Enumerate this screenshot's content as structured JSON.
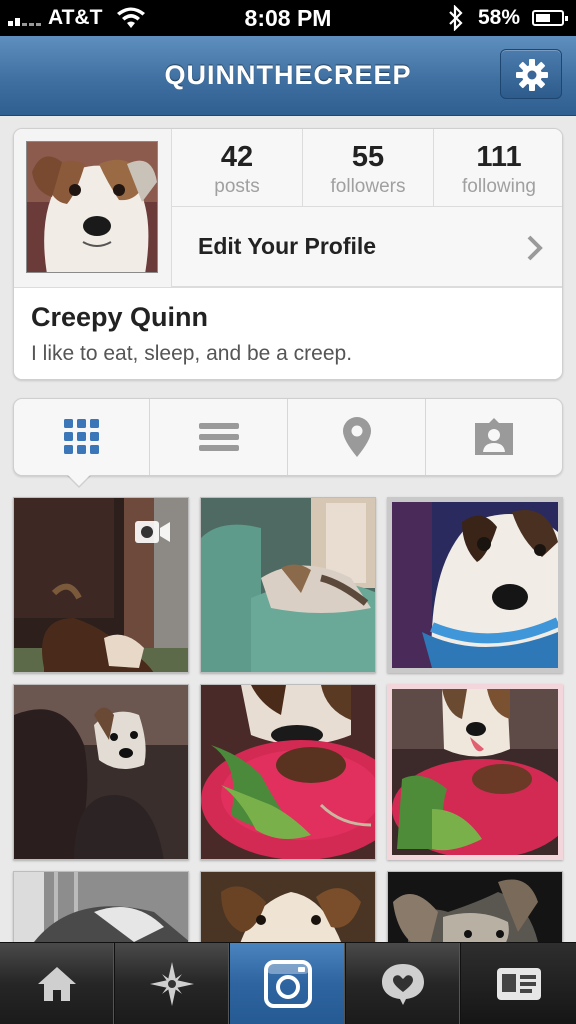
{
  "status_bar": {
    "carrier": "AT&T",
    "time": "8:08 PM",
    "battery_percent_label": "58%",
    "battery_level": 0.58,
    "signal_bars": 2
  },
  "nav_bar": {
    "title": "QUINNTHECREEP",
    "settings_icon": "gear-icon",
    "color": "#3f70a1"
  },
  "profile": {
    "stats": [
      {
        "value": "42",
        "label": "posts"
      },
      {
        "value": "55",
        "label": "followers"
      },
      {
        "value": "111",
        "label": "following"
      }
    ],
    "edit_label": "Edit Your Profile",
    "display_name": "Creepy Quinn",
    "bio": "I like to eat, sleep, and be a creep."
  },
  "view_tabs": [
    {
      "icon": "grid-icon",
      "selected": true
    },
    {
      "icon": "list-icon",
      "selected": false
    },
    {
      "icon": "location-pin-icon",
      "selected": false
    },
    {
      "icon": "tagged-photos-icon",
      "selected": false
    }
  ],
  "photos": [
    {
      "subject": "dog-in-dark-room",
      "is_video": true
    },
    {
      "subject": "dog-on-green-chair",
      "is_video": false
    },
    {
      "subject": "dog-with-blue-scarf",
      "is_video": false
    },
    {
      "subject": "dog-with-person",
      "is_video": false
    },
    {
      "subject": "dog-and-dinner-plate",
      "is_video": false
    },
    {
      "subject": "dog-licking-with-dinner",
      "is_video": false
    },
    {
      "subject": "dog-sleeping-bw",
      "is_video": false
    },
    {
      "subject": "dog-face-closeup",
      "is_video": false
    },
    {
      "subject": "dog-in-dark",
      "is_video": false
    }
  ],
  "tab_bar": [
    {
      "icon": "home-icon",
      "active": false
    },
    {
      "icon": "explore-star-icon",
      "active": false
    },
    {
      "icon": "camera-icon",
      "active": true
    },
    {
      "icon": "activity-heart-icon",
      "active": false
    },
    {
      "icon": "profile-card-icon",
      "active": false
    }
  ],
  "colors": {
    "accent": "#3f70a1",
    "active_tab": "#2e64a0",
    "selected_view_icon": "#3a76b8"
  }
}
